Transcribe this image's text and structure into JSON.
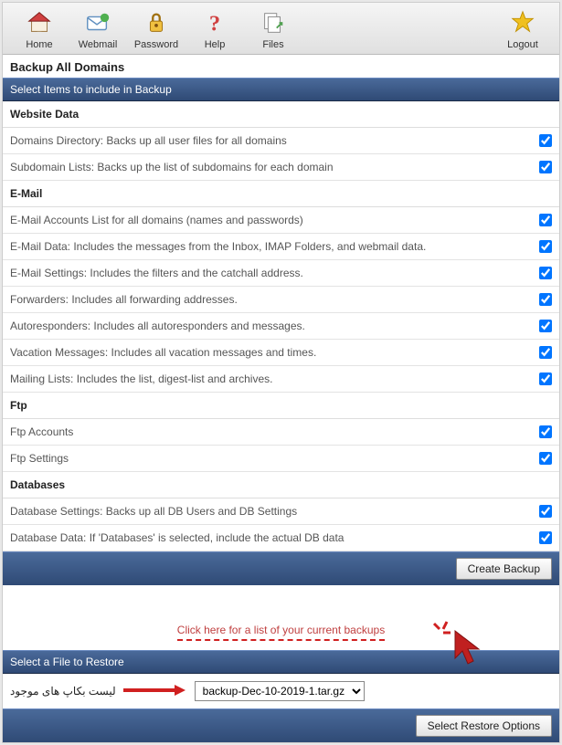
{
  "toolbar": {
    "home": "Home",
    "webmail": "Webmail",
    "password": "Password",
    "help": "Help",
    "files": "Files",
    "logout": "Logout"
  },
  "page_title": "Backup All Domains",
  "section_select_items": "Select Items to include in Backup",
  "groups": {
    "website_data": "Website Data",
    "email": "E-Mail",
    "ftp": "Ftp",
    "databases": "Databases"
  },
  "items": {
    "domains_dir": "Domains Directory: Backs up all user files for all domains",
    "subdomain_lists": "Subdomain Lists: Backs up the list of subdomains for each domain",
    "email_accounts": "E-Mail Accounts List for all domains (names and passwords)",
    "email_data": "E-Mail Data: Includes the messages from the Inbox, IMAP Folders, and webmail data.",
    "email_settings": "E-Mail Settings: Includes the filters and the catchall address.",
    "forwarders": "Forwarders: Includes all forwarding addresses.",
    "autoresponders": "Autoresponders: Includes all autoresponders and messages.",
    "vacation": "Vacation Messages: Includes all vacation messages and times.",
    "mailing_lists": "Mailing Lists: Includes the list, digest-list and archives.",
    "ftp_accounts": "Ftp Accounts",
    "ftp_settings": "Ftp Settings",
    "db_settings": "Database Settings: Backs up all DB Users and DB Settings",
    "db_data": "Database Data: If 'Databases' is selected, include the actual DB data"
  },
  "buttons": {
    "create_backup": "Create Backup",
    "select_restore": "Select Restore Options"
  },
  "backups_link": "Click here for a list of your current backups",
  "section_restore": "Select a File to Restore",
  "restore_label_rtl": "لیست بکاپ های موجود",
  "restore_selected": "backup-Dec-10-2019-1.tar.gz"
}
